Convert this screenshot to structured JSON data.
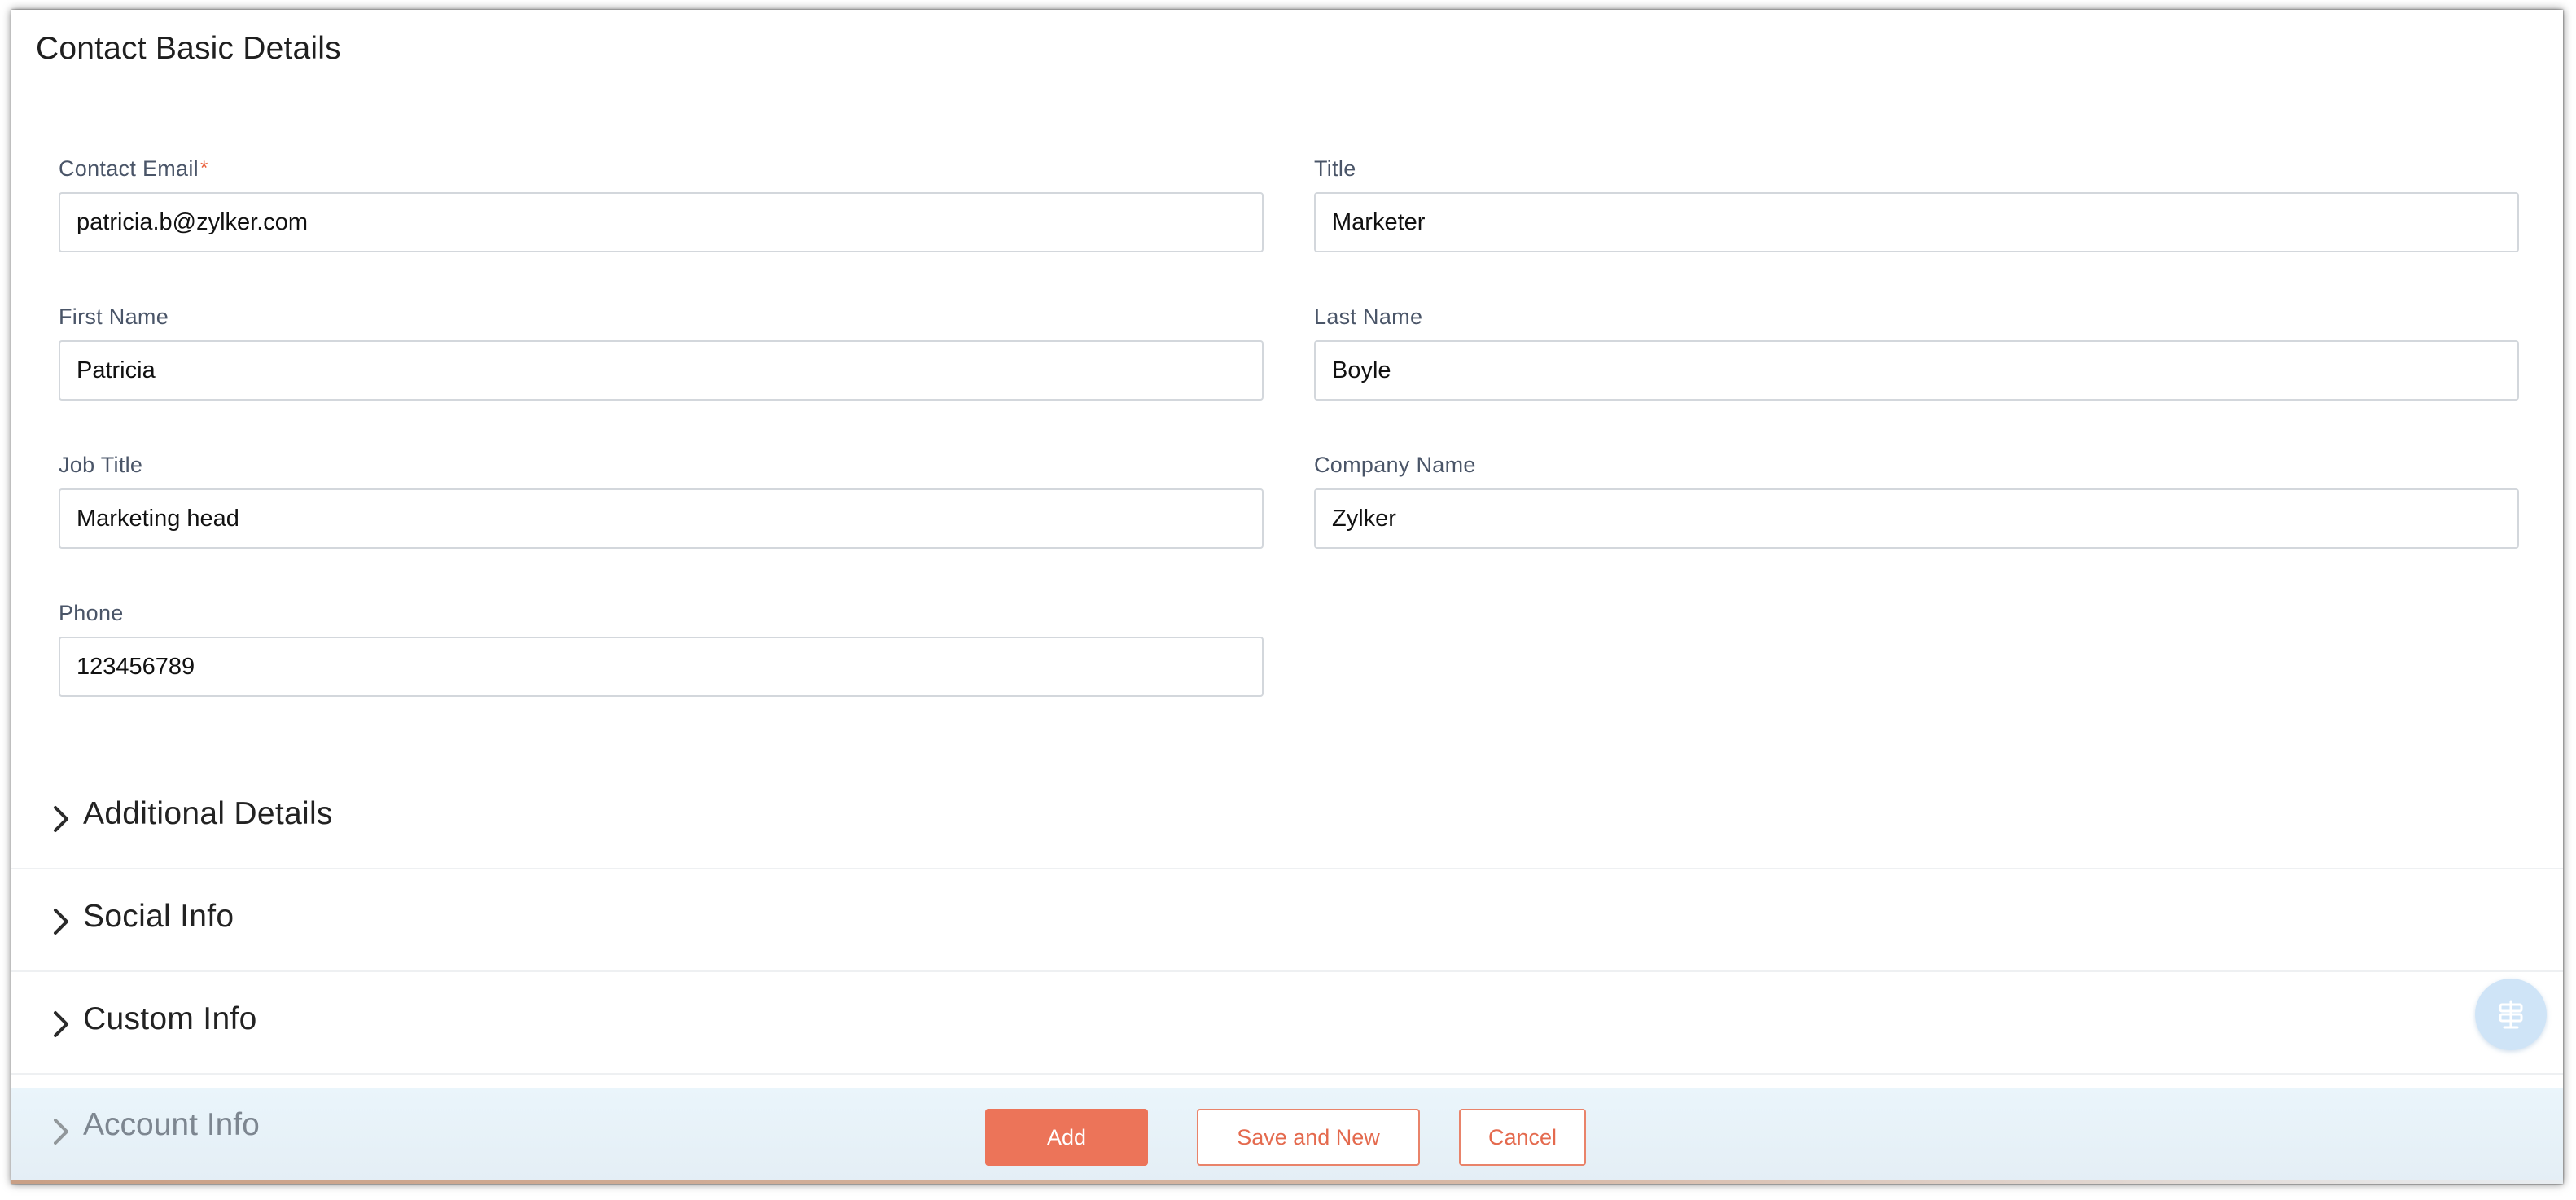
{
  "section_title": "Contact Basic Details",
  "fields": {
    "contact_email": {
      "label": "Contact Email",
      "required_mark": "*",
      "value": "patricia.b@zylker.com"
    },
    "title": {
      "label": "Title",
      "value": "Marketer"
    },
    "first_name": {
      "label": "First Name",
      "value": "Patricia"
    },
    "last_name": {
      "label": "Last Name",
      "value": "Boyle"
    },
    "job_title": {
      "label": "Job Title",
      "value": "Marketing head"
    },
    "company_name": {
      "label": "Company Name",
      "value": "Zylker"
    },
    "phone": {
      "label": "Phone",
      "value": "123456789"
    }
  },
  "accordions": [
    {
      "label": "Additional Details",
      "icon": "chevron-right-icon"
    },
    {
      "label": "Social Info",
      "icon": "chevron-right-icon"
    },
    {
      "label": "Custom Info",
      "icon": "chevron-right-icon"
    },
    {
      "label": "Account Info",
      "icon": "chevron-right-icon"
    }
  ],
  "actions": {
    "add_label": "Add",
    "save_new_label": "Save and New",
    "cancel_label": "Cancel"
  },
  "floating_button": {
    "icon": "signpost-icon"
  },
  "colors": {
    "accent": "#ec7459",
    "accent_text": "#e46a4e",
    "required": "#e9603c",
    "footer_bg": "#eaf5fb",
    "fab_bg": "#cfe4f7"
  }
}
